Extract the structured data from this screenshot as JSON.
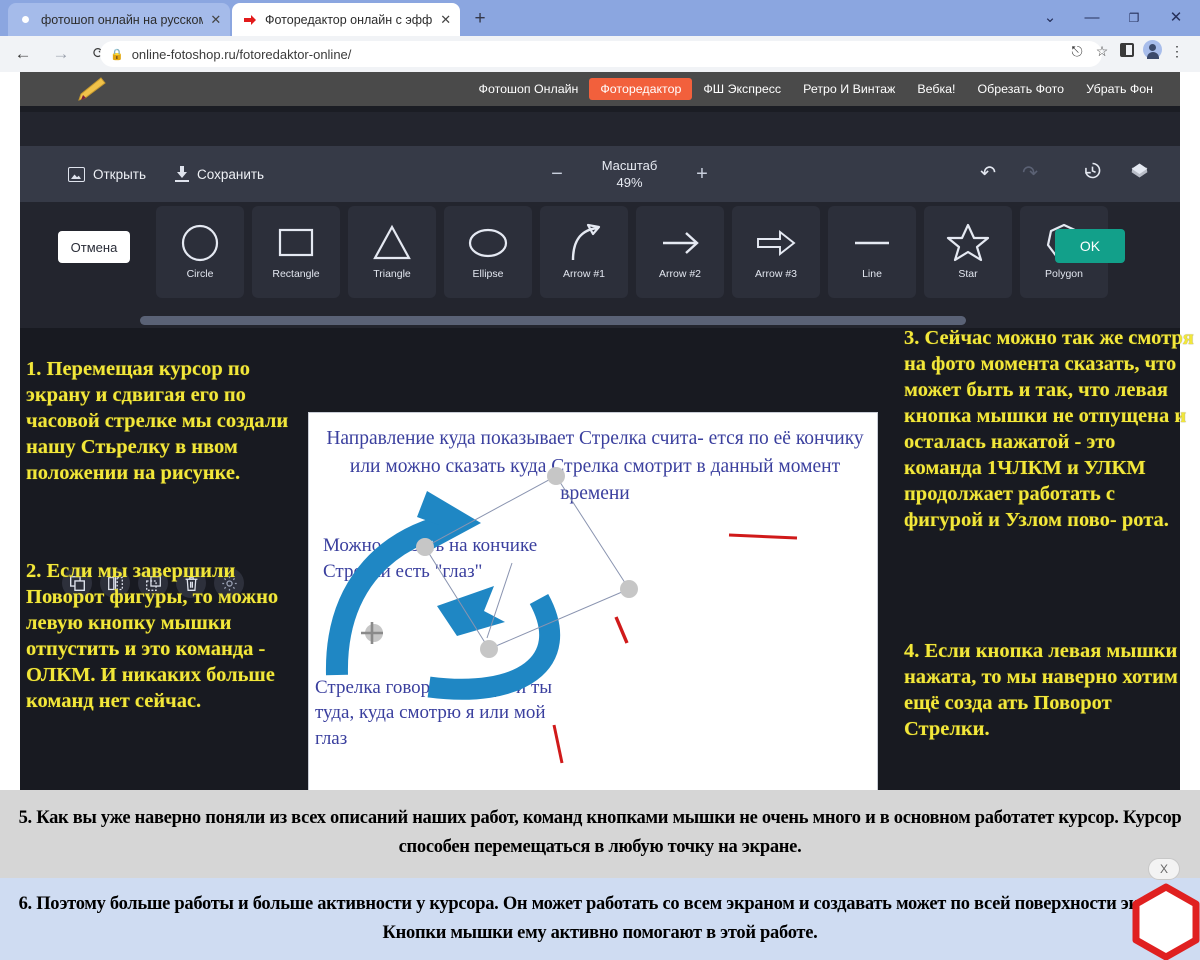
{
  "browser": {
    "tabs": [
      {
        "title": "фотошоп онлайн на русском - Г",
        "favicon": "google-icon",
        "active": false
      },
      {
        "title": "Фоторедактор онлайн с эффект",
        "favicon": "red-arrow-icon",
        "active": true
      }
    ],
    "new_tab_label": "+",
    "window_controls": [
      "chevron-down",
      "minimize",
      "maximize",
      "close"
    ],
    "nav": {
      "back": "←",
      "forward": "→",
      "reload": "C"
    },
    "url": "online-fotoshop.ru/fotoredaktor-online/",
    "lock_icon": "lock-icon",
    "toolbar_icons": [
      "share-icon",
      "bookmark-star-icon",
      "side-panel-icon",
      "profile-avatar",
      "chrome-menu-icon"
    ]
  },
  "site_nav": {
    "logo": "paintbrush-icon",
    "items": [
      {
        "label": "Фотошоп Онлайн",
        "active": false
      },
      {
        "label": "Фоторедактор",
        "active": true
      },
      {
        "label": "ФШ Экспресс",
        "active": false
      },
      {
        "label": "Ретро И Винтаж",
        "active": false
      },
      {
        "label": "Вебка!",
        "active": false
      },
      {
        "label": "Обрезать Фото",
        "active": false
      },
      {
        "label": "Убрать Фон",
        "active": false
      }
    ],
    "accent_color": "#f2603c"
  },
  "editor": {
    "open_label": "Открыть",
    "save_label": "Сохранить",
    "zoom": {
      "title": "Масштаб",
      "value": "49%",
      "minus": "−",
      "plus": "+"
    },
    "history_icons": [
      "undo-icon",
      "redo-icon",
      "history-icon",
      "layers-icon"
    ],
    "cancel_label": "Отмена",
    "ok_label": "OK",
    "shapes": [
      {
        "label": "Circle",
        "icon": "circle-icon"
      },
      {
        "label": "Rectangle",
        "icon": "rectangle-icon"
      },
      {
        "label": "Triangle",
        "icon": "triangle-icon"
      },
      {
        "label": "Ellipse",
        "icon": "ellipse-icon"
      },
      {
        "label": "Arrow #1",
        "icon": "curved-arrow-icon"
      },
      {
        "label": "Arrow #2",
        "icon": "straight-arrow-icon"
      },
      {
        "label": "Arrow #3",
        "icon": "outline-arrow-icon"
      },
      {
        "label": "Line",
        "icon": "line-icon"
      },
      {
        "label": "Star",
        "icon": "star-icon"
      },
      {
        "label": "Polygon",
        "icon": "polygon-icon"
      }
    ],
    "mini_tools": [
      "duplicate-icon",
      "flip-horizontal-icon",
      "resize-icon",
      "delete-icon",
      "settings-gear-icon"
    ]
  },
  "canvas": {
    "text_top": "Направление куда показывает Стрелка счита- ется по её кончику или можно сказать куда Стрелка смотрит в данный момент времени",
    "text_middle": "Можно сказать на кончике Стрелки есть \"глаз\"",
    "text_lower": "Стрелка говорит смотри и ты туда, куда смотрю я или мой глаз",
    "text_color": "#3a3f9e",
    "shape_color": "#1f87c4",
    "selection": {
      "handles": 4,
      "rotate_node": "rotation-handle"
    }
  },
  "annotations": {
    "note1": "1. Перемещая курсор по экрану и сдвигая его по часовой стрелке мы создали нашу Стьрелку в нвом положении на рисунке.",
    "note2": "2. Если мы завершили Поворот фигуры, то можно левую кнопку мышки отпустить и это команда - ОЛКМ. И никаких больше команд нет сейчас.",
    "note3": "3. Сейчас можно так же смотря на фото момента сказать, что может быть и так, что левая кнопка мышки не отпущена и осталась нажатой - это команда 1ЧЛКМ и УЛКМ продолжает работать с фигурой и Узлом пово- рота.",
    "note4": "4. Если кнопка левая мышки нажата, то мы наверно хотим ещё созда ать Поворот Стрелки.",
    "note5": "5. Как вы уже наверно поняли из всех описаний наших работ, команд кнопками мышки не очень много и в основном работатет курсор. Курсор способен перемещаться в любую точку на экране.",
    "note6": "6. Поэтому больше работы и больше активности у курсора. Он может работать со всем экраном и создавать может по всей поверхности экрана. Кнопки мышки ему активно помогают в этой работе.",
    "text_color": "#f2e73a"
  },
  "overlay": {
    "close_label": "X",
    "hexagon": "red-hexagon-shape",
    "hexagon_color": "#e02020"
  }
}
